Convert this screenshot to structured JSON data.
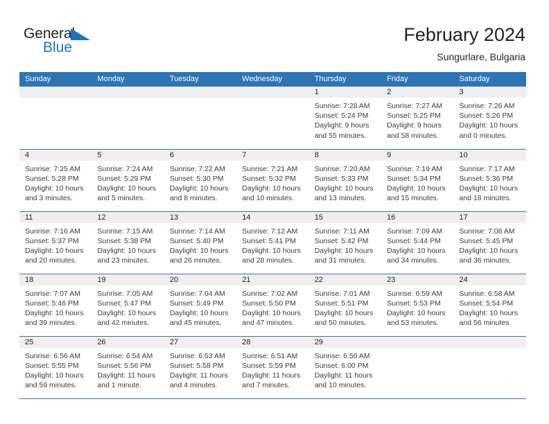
{
  "brand": {
    "name_top": "General",
    "name_bottom": "Blue",
    "triangle_icon": "triangle-icon",
    "color_dark": "#231f20",
    "color_blue": "#1b75bb"
  },
  "header": {
    "title": "February 2024",
    "subtitle": "Sungurlare, Bulgaria"
  },
  "theme": {
    "header_blue": "#2e75b6",
    "band_gray": "#efefef",
    "text": "#231f20"
  },
  "columns": [
    "Sunday",
    "Monday",
    "Tuesday",
    "Wednesday",
    "Thursday",
    "Friday",
    "Saturday"
  ],
  "weeks": [
    [
      {
        "day": "",
        "empty": true
      },
      {
        "day": "",
        "empty": true
      },
      {
        "day": "",
        "empty": true
      },
      {
        "day": "",
        "empty": true
      },
      {
        "day": "1",
        "sunrise": "Sunrise: 7:28 AM",
        "sunset": "Sunset: 5:24 PM",
        "daylight1": "Daylight: 9 hours",
        "daylight2": "and 55 minutes."
      },
      {
        "day": "2",
        "sunrise": "Sunrise: 7:27 AM",
        "sunset": "Sunset: 5:25 PM",
        "daylight1": "Daylight: 9 hours",
        "daylight2": "and 58 minutes."
      },
      {
        "day": "3",
        "sunrise": "Sunrise: 7:26 AM",
        "sunset": "Sunset: 5:26 PM",
        "daylight1": "Daylight: 10 hours",
        "daylight2": "and 0 minutes."
      }
    ],
    [
      {
        "day": "4",
        "sunrise": "Sunrise: 7:25 AM",
        "sunset": "Sunset: 5:28 PM",
        "daylight1": "Daylight: 10 hours",
        "daylight2": "and 3 minutes."
      },
      {
        "day": "5",
        "sunrise": "Sunrise: 7:24 AM",
        "sunset": "Sunset: 5:29 PM",
        "daylight1": "Daylight: 10 hours",
        "daylight2": "and 5 minutes."
      },
      {
        "day": "6",
        "sunrise": "Sunrise: 7:22 AM",
        "sunset": "Sunset: 5:30 PM",
        "daylight1": "Daylight: 10 hours",
        "daylight2": "and 8 minutes."
      },
      {
        "day": "7",
        "sunrise": "Sunrise: 7:21 AM",
        "sunset": "Sunset: 5:32 PM",
        "daylight1": "Daylight: 10 hours",
        "daylight2": "and 10 minutes."
      },
      {
        "day": "8",
        "sunrise": "Sunrise: 7:20 AM",
        "sunset": "Sunset: 5:33 PM",
        "daylight1": "Daylight: 10 hours",
        "daylight2": "and 13 minutes."
      },
      {
        "day": "9",
        "sunrise": "Sunrise: 7:19 AM",
        "sunset": "Sunset: 5:34 PM",
        "daylight1": "Daylight: 10 hours",
        "daylight2": "and 15 minutes."
      },
      {
        "day": "10",
        "sunrise": "Sunrise: 7:17 AM",
        "sunset": "Sunset: 5:36 PM",
        "daylight1": "Daylight: 10 hours",
        "daylight2": "and 18 minutes."
      }
    ],
    [
      {
        "day": "11",
        "sunrise": "Sunrise: 7:16 AM",
        "sunset": "Sunset: 5:37 PM",
        "daylight1": "Daylight: 10 hours",
        "daylight2": "and 20 minutes."
      },
      {
        "day": "12",
        "sunrise": "Sunrise: 7:15 AM",
        "sunset": "Sunset: 5:38 PM",
        "daylight1": "Daylight: 10 hours",
        "daylight2": "and 23 minutes."
      },
      {
        "day": "13",
        "sunrise": "Sunrise: 7:14 AM",
        "sunset": "Sunset: 5:40 PM",
        "daylight1": "Daylight: 10 hours",
        "daylight2": "and 26 minutes."
      },
      {
        "day": "14",
        "sunrise": "Sunrise: 7:12 AM",
        "sunset": "Sunset: 5:41 PM",
        "daylight1": "Daylight: 10 hours",
        "daylight2": "and 28 minutes."
      },
      {
        "day": "15",
        "sunrise": "Sunrise: 7:11 AM",
        "sunset": "Sunset: 5:42 PM",
        "daylight1": "Daylight: 10 hours",
        "daylight2": "and 31 minutes."
      },
      {
        "day": "16",
        "sunrise": "Sunrise: 7:09 AM",
        "sunset": "Sunset: 5:44 PM",
        "daylight1": "Daylight: 10 hours",
        "daylight2": "and 34 minutes."
      },
      {
        "day": "17",
        "sunrise": "Sunrise: 7:08 AM",
        "sunset": "Sunset: 5:45 PM",
        "daylight1": "Daylight: 10 hours",
        "daylight2": "and 36 minutes."
      }
    ],
    [
      {
        "day": "18",
        "sunrise": "Sunrise: 7:07 AM",
        "sunset": "Sunset: 5:46 PM",
        "daylight1": "Daylight: 10 hours",
        "daylight2": "and 39 minutes."
      },
      {
        "day": "19",
        "sunrise": "Sunrise: 7:05 AM",
        "sunset": "Sunset: 5:47 PM",
        "daylight1": "Daylight: 10 hours",
        "daylight2": "and 42 minutes."
      },
      {
        "day": "20",
        "sunrise": "Sunrise: 7:04 AM",
        "sunset": "Sunset: 5:49 PM",
        "daylight1": "Daylight: 10 hours",
        "daylight2": "and 45 minutes."
      },
      {
        "day": "21",
        "sunrise": "Sunrise: 7:02 AM",
        "sunset": "Sunset: 5:50 PM",
        "daylight1": "Daylight: 10 hours",
        "daylight2": "and 47 minutes."
      },
      {
        "day": "22",
        "sunrise": "Sunrise: 7:01 AM",
        "sunset": "Sunset: 5:51 PM",
        "daylight1": "Daylight: 10 hours",
        "daylight2": "and 50 minutes."
      },
      {
        "day": "23",
        "sunrise": "Sunrise: 6:59 AM",
        "sunset": "Sunset: 5:53 PM",
        "daylight1": "Daylight: 10 hours",
        "daylight2": "and 53 minutes."
      },
      {
        "day": "24",
        "sunrise": "Sunrise: 6:58 AM",
        "sunset": "Sunset: 5:54 PM",
        "daylight1": "Daylight: 10 hours",
        "daylight2": "and 56 minutes."
      }
    ],
    [
      {
        "day": "25",
        "sunrise": "Sunrise: 6:56 AM",
        "sunset": "Sunset: 5:55 PM",
        "daylight1": "Daylight: 10 hours",
        "daylight2": "and 59 minutes."
      },
      {
        "day": "26",
        "sunrise": "Sunrise: 6:54 AM",
        "sunset": "Sunset: 5:56 PM",
        "daylight1": "Daylight: 11 hours",
        "daylight2": "and 1 minute."
      },
      {
        "day": "27",
        "sunrise": "Sunrise: 6:53 AM",
        "sunset": "Sunset: 5:58 PM",
        "daylight1": "Daylight: 11 hours",
        "daylight2": "and 4 minutes."
      },
      {
        "day": "28",
        "sunrise": "Sunrise: 6:51 AM",
        "sunset": "Sunset: 5:59 PM",
        "daylight1": "Daylight: 11 hours",
        "daylight2": "and 7 minutes."
      },
      {
        "day": "29",
        "sunrise": "Sunrise: 6:50 AM",
        "sunset": "Sunset: 6:00 PM",
        "daylight1": "Daylight: 11 hours",
        "daylight2": "and 10 minutes."
      },
      {
        "day": "",
        "empty": true
      },
      {
        "day": "",
        "empty": true
      }
    ]
  ]
}
